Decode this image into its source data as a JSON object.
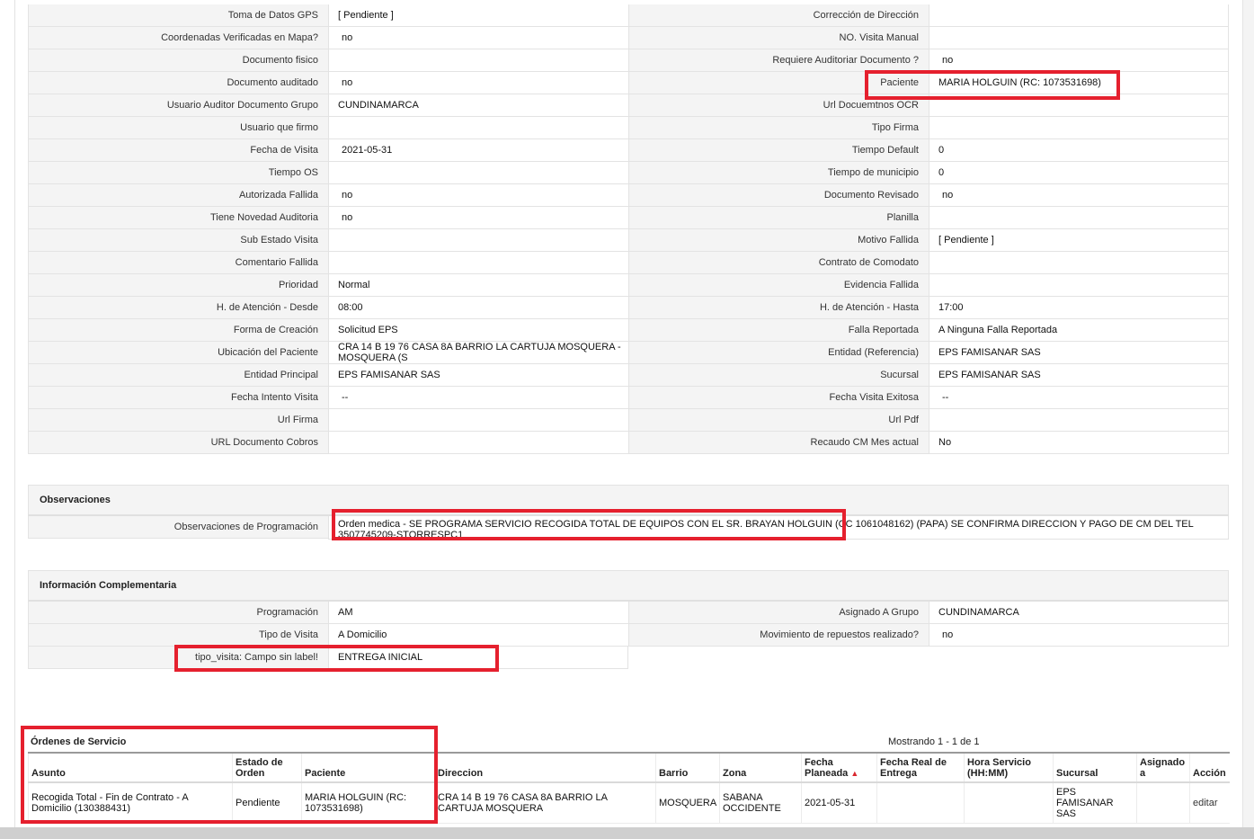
{
  "detail_rows": [
    {
      "l1": "Toma de Datos GPS",
      "v1": "[ Pendiente ]",
      "l2": "Corrección de Dirección",
      "v2": ""
    },
    {
      "l1": "Coordenadas Verificadas en Mapa?",
      "v1": "no",
      "l2": "NO. Visita Manual",
      "v2": ""
    },
    {
      "l1": "Documento fisico",
      "v1": "",
      "l2": "Requiere Auditoriar Documento ?",
      "v2": "no"
    },
    {
      "l1": "Documento auditado",
      "v1": "no",
      "l2": "Paciente",
      "v2": "MARIA HOLGUIN (RC: 1073531698)"
    },
    {
      "l1": "Usuario Auditor Documento Grupo",
      "v1": "CUNDINAMARCA",
      "l2": "Url Docuemtnos OCR",
      "v2": ""
    },
    {
      "l1": "Usuario que firmo",
      "v1": "",
      "l2": "Tipo Firma",
      "v2": ""
    },
    {
      "l1": "Fecha de Visita",
      "v1": "2021-05-31",
      "l2": "Tiempo Default",
      "v2": "0"
    },
    {
      "l1": "Tiempo OS",
      "v1": "",
      "l2": "Tiempo de municipio",
      "v2": "0"
    },
    {
      "l1": "Autorizada Fallida",
      "v1": "no",
      "l2": "Documento Revisado",
      "v2": "no"
    },
    {
      "l1": "Tiene Novedad Auditoria",
      "v1": "no",
      "l2": "Planilla",
      "v2": ""
    },
    {
      "l1": "Sub Estado Visita",
      "v1": "",
      "l2": "Motivo Fallida",
      "v2": "[ Pendiente ]"
    },
    {
      "l1": "Comentario Fallida",
      "v1": "",
      "l2": "Contrato de Comodato",
      "v2": ""
    },
    {
      "l1": "Prioridad",
      "v1": "Normal",
      "l2": "Evidencia Fallida",
      "v2": ""
    },
    {
      "l1": "H. de Atención - Desde",
      "v1": "08:00",
      "l2": "H. de Atención - Hasta",
      "v2": "17:00"
    },
    {
      "l1": "Forma de Creación",
      "v1": "Solicitud EPS",
      "l2": "Falla Reportada",
      "v2": "A Ninguna Falla Reportada"
    },
    {
      "l1": "Ubicación del Paciente",
      "v1": "CRA 14 B 19 76 CASA 8A BARRIO LA CARTUJA MOSQUERA - MOSQUERA (S",
      "l2": "Entidad (Referencia)",
      "v2": "EPS FAMISANAR SAS"
    },
    {
      "l1": "Entidad Principal",
      "v1": "EPS FAMISANAR SAS",
      "l2": "Sucursal",
      "v2": "EPS FAMISANAR SAS"
    },
    {
      "l1": "Fecha Intento Visita",
      "v1": "--",
      "l2": "Fecha Visita Exitosa",
      "v2": "--"
    },
    {
      "l1": "Url Firma",
      "v1": "",
      "l2": "Url Pdf",
      "v2": ""
    },
    {
      "l1": "URL Documento Cobros",
      "v1": "",
      "l2": "Recaudo CM Mes actual",
      "v2": "No"
    }
  ],
  "observaciones": {
    "title": "Observaciones",
    "label": "Observaciones de Programación",
    "value": "Orden medica - SE PROGRAMA SERVICIO RECOGIDA TOTAL DE EQUIPOS CON EL SR. BRAYAN HOLGUIN (CC 1061048162) (PAPA) SE CONFIRMA DIRECCION Y PAGO DE CM DEL TEL 3507745209-STORRESPC1"
  },
  "complementaria": {
    "title": "Información Complementaria",
    "rows": [
      {
        "l1": "Programación",
        "v1": "AM",
        "l2": "Asignado A Grupo",
        "v2": "CUNDINAMARCA"
      },
      {
        "l1": "Tipo de Visita",
        "v1": "A Domicilio",
        "l2": "Movimiento de repuestos realizado?",
        "v2": "no"
      }
    ],
    "extra": {
      "label": "tipo_visita: Campo sin label!",
      "value": "ENTREGA INICIAL"
    }
  },
  "orders": {
    "title": "Órdenes de Servicio",
    "count_text": "Mostrando 1 - 1 de 1",
    "columns": [
      "Asunto",
      "Estado de Orden",
      "Paciente",
      "Direccion",
      "Barrio",
      "Zona",
      "Fecha Planeada",
      "Fecha Real de Entrega",
      "Hora Servicio (HH:MM)",
      "Sucursal",
      "Asignado a",
      "Acción"
    ],
    "rows": [
      {
        "asunto": "Recogida Total - Fin de Contrato - A Domicilio (130388431)",
        "estado": "Pendiente",
        "paciente": "MARIA HOLGUIN (RC: 1073531698)",
        "direccion": "CRA 14 B 19 76 CASA 8A BARRIO LA CARTUJA MOSQUERA",
        "barrio": "MOSQUERA",
        "zona": "SABANA OCCIDENTE",
        "fecha_planeada": "2021-05-31",
        "fecha_real": "",
        "hora": "",
        "sucursal": "EPS FAMISANAR SAS",
        "asignado": "",
        "accion": "editar"
      }
    ]
  },
  "colors": {
    "highlight": "#e5202e",
    "label_bg": "#f4f4f4",
    "border": "#e3e3e3",
    "sort_arrow": "#d9272e"
  },
  "icons": {
    "sort": "sort-up-triangle-icon"
  }
}
